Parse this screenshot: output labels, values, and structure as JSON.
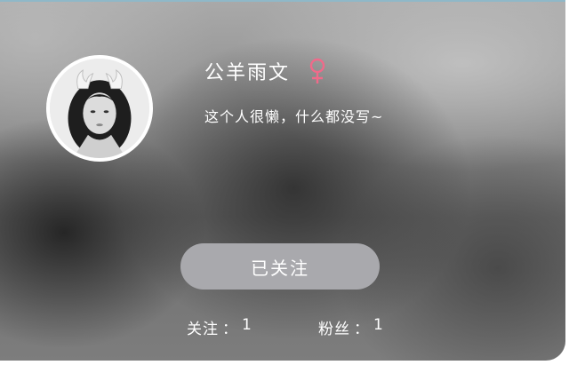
{
  "profile": {
    "name": "公羊雨文",
    "gender_icon": "female-symbol-icon",
    "gender_color": "#f06a8a",
    "signature": "这个人很懒，什么都没写~",
    "avatar": "avatar-photo"
  },
  "actions": {
    "follow_label": "已关注"
  },
  "stats": {
    "following_label": "关注",
    "following_sep": "：",
    "following_count": "1",
    "fans_label": "粉丝",
    "fans_sep": "：",
    "fans_count": "1"
  },
  "colors": {
    "button_bg": "#a9a9ad",
    "text": "#ffffff"
  }
}
